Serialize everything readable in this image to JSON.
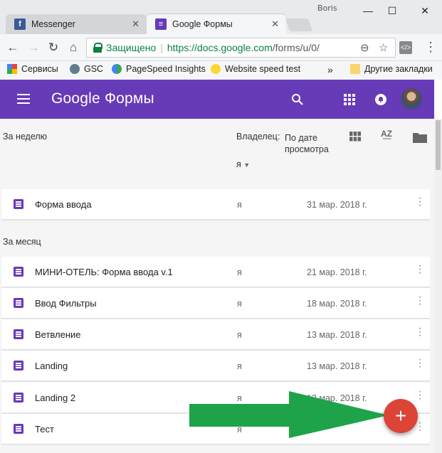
{
  "window": {
    "user": "Boris",
    "minimize": "—",
    "maximize": "☐",
    "close": "✕"
  },
  "tabs": [
    {
      "label": "Messenger",
      "favicon": "f"
    },
    {
      "label": "Google Формы",
      "favicon": "≡"
    }
  ],
  "tab_close": "✕",
  "address": {
    "secure_label": "Защищено",
    "separator": "|",
    "url_host": "https://docs.google.com",
    "url_path": "/forms/u/0/"
  },
  "bookmarks": {
    "items": [
      "Сервисы",
      "GSC",
      "PageSpeed Insights",
      "Website speed test"
    ],
    "overflow": "»",
    "other": "Другие закладки"
  },
  "app": {
    "title": "Google Формы"
  },
  "list": {
    "sections": [
      "За неделю",
      "За месяц"
    ],
    "owner_header": "Владелец:",
    "owner_value": "я",
    "date_header": "По дате просмотра",
    "rows": [
      {
        "name": "Форма ввода",
        "owner": "я",
        "date": "31 мар. 2018 г."
      },
      {
        "name": "МИНИ-ОТЕЛЬ: Форма ввода v.1",
        "owner": "я",
        "date": "21 мар. 2018 г."
      },
      {
        "name": "Ввод Фильтры",
        "owner": "я",
        "date": "18 мар. 2018 г."
      },
      {
        "name": "Ветвление",
        "owner": "я",
        "date": "13 мар. 2018 г."
      },
      {
        "name": "Landing",
        "owner": "я",
        "date": "13 мар. 2018 г."
      },
      {
        "name": "Landing 2",
        "owner": "я",
        "date": "13 мар. 2018 г."
      },
      {
        "name": "Тест",
        "owner": "я",
        "date": ""
      }
    ]
  },
  "fab": {
    "label": "+"
  },
  "colors": {
    "brand": "#673ab7",
    "fab": "#db4437",
    "arrow": "#1fa34a",
    "secure": "#0b8043"
  }
}
